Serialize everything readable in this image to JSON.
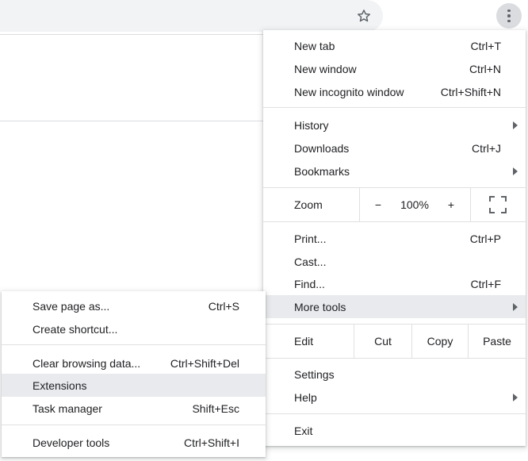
{
  "toolbar": {
    "star_icon": "star-outline-icon",
    "menu_icon": "three-dots-vertical-icon"
  },
  "main_menu": {
    "new_tab": {
      "label": "New tab",
      "shortcut": "Ctrl+T"
    },
    "new_window": {
      "label": "New window",
      "shortcut": "Ctrl+N"
    },
    "new_incognito": {
      "label": "New incognito window",
      "shortcut": "Ctrl+Shift+N"
    },
    "history": {
      "label": "History"
    },
    "downloads": {
      "label": "Downloads",
      "shortcut": "Ctrl+J"
    },
    "bookmarks": {
      "label": "Bookmarks"
    },
    "zoom": {
      "label": "Zoom",
      "minus": "−",
      "value": "100%",
      "plus": "+"
    },
    "print": {
      "label": "Print...",
      "shortcut": "Ctrl+P"
    },
    "cast": {
      "label": "Cast..."
    },
    "find": {
      "label": "Find...",
      "shortcut": "Ctrl+F"
    },
    "more_tools": {
      "label": "More tools"
    },
    "edit": {
      "label": "Edit",
      "cut": "Cut",
      "copy": "Copy",
      "paste": "Paste"
    },
    "settings": {
      "label": "Settings"
    },
    "help": {
      "label": "Help"
    },
    "exit": {
      "label": "Exit"
    }
  },
  "more_tools_menu": {
    "save_page": {
      "label": "Save page as...",
      "shortcut": "Ctrl+S"
    },
    "create_shortcut": {
      "label": "Create shortcut..."
    },
    "clear_data": {
      "label": "Clear browsing data...",
      "shortcut": "Ctrl+Shift+Del"
    },
    "extensions": {
      "label": "Extensions"
    },
    "task_manager": {
      "label": "Task manager",
      "shortcut": "Shift+Esc"
    },
    "dev_tools": {
      "label": "Developer tools",
      "shortcut": "Ctrl+Shift+I"
    }
  },
  "colors": {
    "highlight": "#e8eaed",
    "separator": "#e0e0e0",
    "omnibox": "#f1f3f4"
  }
}
